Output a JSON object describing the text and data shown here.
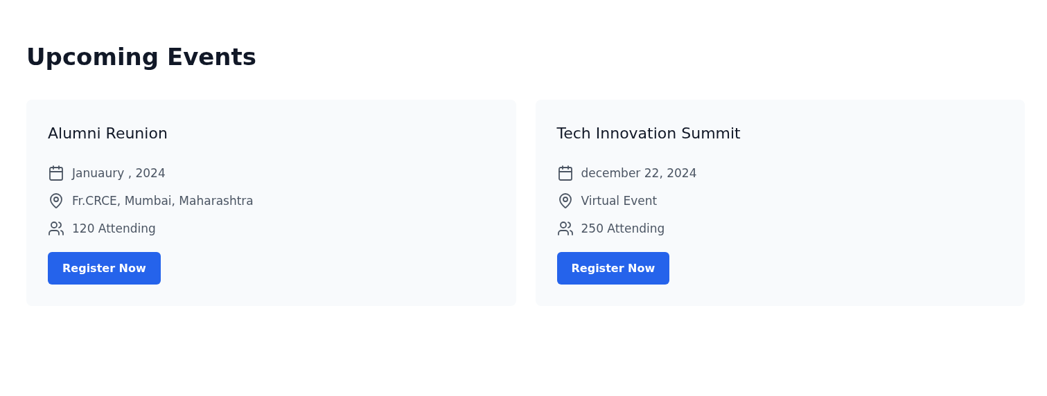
{
  "heading": "Upcoming Events",
  "events": [
    {
      "title": "Alumni Reunion",
      "details": [
        {
          "kind": "date",
          "text": "Januaury , 2024"
        },
        {
          "kind": "location",
          "text": "Fr.CRCE, Mumbai, Maharashtra"
        },
        {
          "kind": "attendees",
          "text": "120 Attending"
        }
      ],
      "button": "Register Now"
    },
    {
      "title": "Tech Innovation Summit",
      "details": [
        {
          "kind": "date",
          "text": "december 22, 2024"
        },
        {
          "kind": "location",
          "text": "Virtual Event"
        },
        {
          "kind": "attendees",
          "text": "250 Attending"
        }
      ],
      "button": "Register Now"
    }
  ]
}
